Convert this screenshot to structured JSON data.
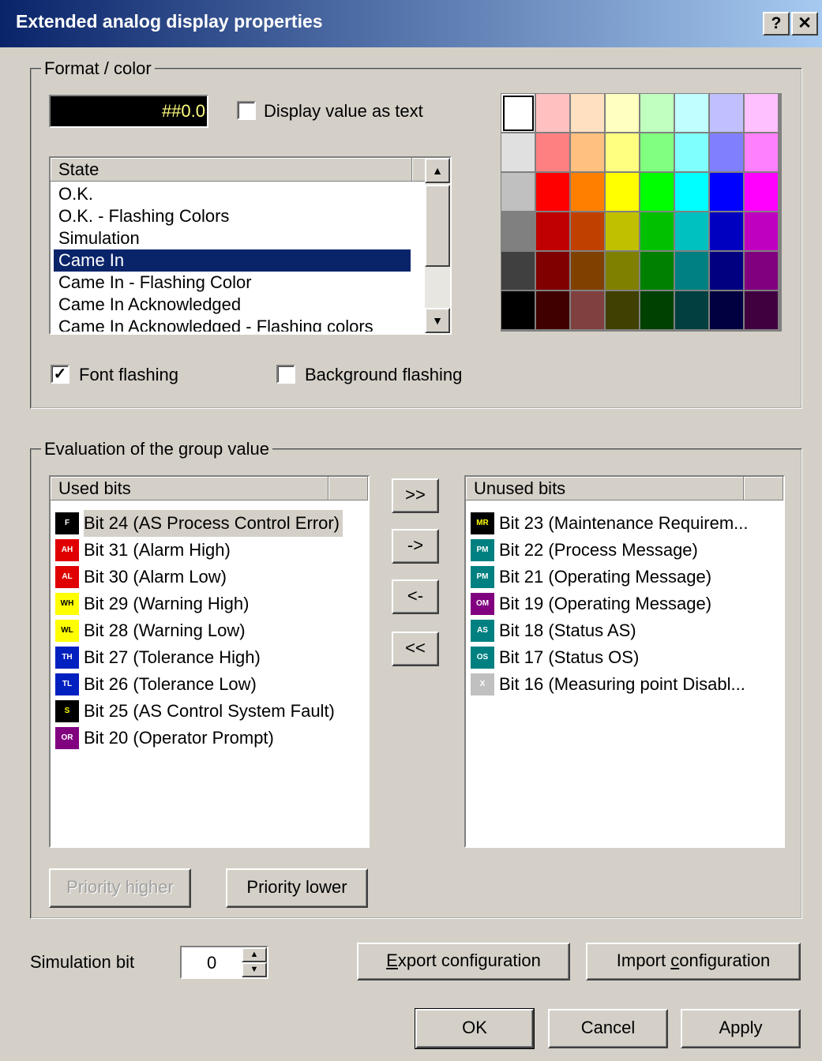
{
  "window": {
    "title": "Extended analog display properties",
    "help_label": "?",
    "close_label": "✕"
  },
  "format_group": {
    "label": "Format / color",
    "format_value": "##0.0",
    "display_as_text_label": "Display value as text",
    "display_as_text_checked": false,
    "state_header": "State",
    "states": [
      "O.K.",
      "O.K. - Flashing Colors",
      "Simulation",
      "Came In",
      "Came In - Flashing Color",
      "Came In Acknowledged",
      "Came In Acknowledged - Flashing colors"
    ],
    "selected_state": "Came In",
    "font_flashing_label": "Font flashing",
    "font_flashing_checked": true,
    "background_flashing_label": "Background flashing",
    "background_flashing_checked": false,
    "palette_rows": [
      [
        "#ffffff",
        "#ffc0c0",
        "#ffe0c0",
        "#ffffc0",
        "#c0ffc0",
        "#c0ffff",
        "#c0c0ff",
        "#ffc0ff"
      ],
      [
        "#e0e0e0",
        "#ff8080",
        "#ffc080",
        "#ffff80",
        "#80ff80",
        "#80ffff",
        "#8080ff",
        "#ff80ff"
      ],
      [
        "#c0c0c0",
        "#ff0000",
        "#ff8000",
        "#ffff00",
        "#00ff00",
        "#00ffff",
        "#0000ff",
        "#ff00ff"
      ],
      [
        "#808080",
        "#c00000",
        "#c04000",
        "#c0c000",
        "#00c000",
        "#00c0c0",
        "#0000c0",
        "#c000c0"
      ],
      [
        "#404040",
        "#800000",
        "#804000",
        "#808000",
        "#008000",
        "#008080",
        "#000080",
        "#800080"
      ],
      [
        "#000000",
        "#400000",
        "#804040",
        "#404000",
        "#004000",
        "#004040",
        "#000040",
        "#400040"
      ]
    ]
  },
  "eval_group": {
    "label": "Evaluation of the group value",
    "used_header": "Used bits",
    "unused_header": "Unused bits",
    "used_bits": [
      {
        "badge": "F",
        "badge_bg": "#000000",
        "badge_fg": "#ffffff",
        "label": "Bit 24 (AS Process Control Error)"
      },
      {
        "badge": "AH",
        "badge_bg": "#e00000",
        "badge_fg": "#ffffff",
        "label": "Bit 31 (Alarm High)"
      },
      {
        "badge": "AL",
        "badge_bg": "#e00000",
        "badge_fg": "#ffffff",
        "label": "Bit 30 (Alarm Low)"
      },
      {
        "badge": "WH",
        "badge_bg": "#ffff00",
        "badge_fg": "#000000",
        "label": "Bit 29 (Warning High)"
      },
      {
        "badge": "WL",
        "badge_bg": "#ffff00",
        "badge_fg": "#000000",
        "label": "Bit 28 (Warning Low)"
      },
      {
        "badge": "TH",
        "badge_bg": "#0020c0",
        "badge_fg": "#ffffff",
        "label": "Bit 27 (Tolerance High)"
      },
      {
        "badge": "TL",
        "badge_bg": "#0020c0",
        "badge_fg": "#ffffff",
        "label": "Bit 26 (Tolerance Low)"
      },
      {
        "badge": "S",
        "badge_bg": "#000000",
        "badge_fg": "#ffff00",
        "label": "Bit 25 (AS Control System Fault)"
      },
      {
        "badge": "OR",
        "badge_bg": "#800080",
        "badge_fg": "#ffffff",
        "label": "Bit 20 (Operator Prompt)"
      }
    ],
    "unused_bits": [
      {
        "badge": "MR",
        "badge_bg": "#000000",
        "badge_fg": "#ffff00",
        "label": "Bit 23 (Maintenance Requirem..."
      },
      {
        "badge": "PM",
        "badge_bg": "#008080",
        "badge_fg": "#ffffff",
        "label": "Bit 22 (Process Message)"
      },
      {
        "badge": "PM",
        "badge_bg": "#008080",
        "badge_fg": "#ffffff",
        "label": "Bit 21 (Operating Message)"
      },
      {
        "badge": "OM",
        "badge_bg": "#800080",
        "badge_fg": "#ffffff",
        "label": "Bit 19 (Operating Message)"
      },
      {
        "badge": "AS",
        "badge_bg": "#008080",
        "badge_fg": "#ffffff",
        "label": "Bit 18 (Status AS)"
      },
      {
        "badge": "OS",
        "badge_bg": "#008080",
        "badge_fg": "#ffffff",
        "label": "Bit 17 (Status OS)"
      },
      {
        "badge": "X",
        "badge_bg": "#c0c0c0",
        "badge_fg": "#ffffff",
        "label": "Bit 16 (Measuring point Disabl..."
      }
    ],
    "move_all_right_label": ">>",
    "move_right_label": "->",
    "move_left_label": "<-",
    "move_all_left_label": "<<",
    "priority_higher_label": "Priority higher",
    "priority_lower_label": "Priority lower"
  },
  "footer": {
    "simulation_label": "Simulation bit",
    "simulation_value": "0",
    "export_label_mnemonic": "E",
    "export_label_rest": "xport configuration",
    "import_label_pre": "Import ",
    "import_label_mnemonic": "c",
    "import_label_rest": "onfiguration",
    "ok_label": "OK",
    "cancel_label": "Cancel",
    "apply_label": "Apply"
  }
}
